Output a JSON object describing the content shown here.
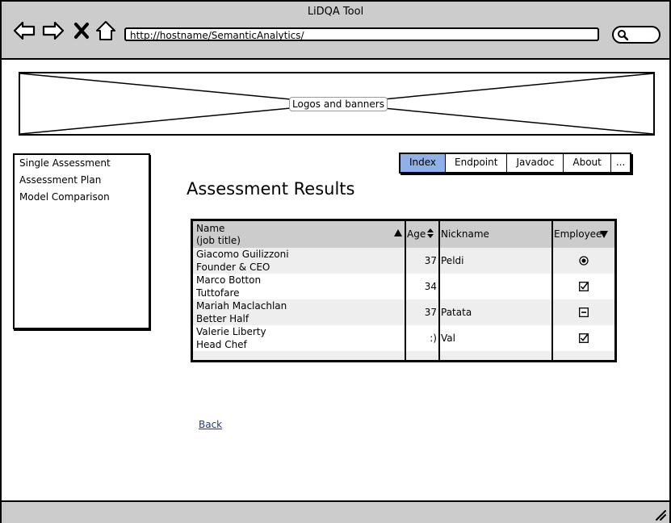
{
  "window": {
    "title": "LiDQA Tool"
  },
  "browser": {
    "url": "http://hostname/SemanticAnalytics/",
    "icons": [
      "back-arrow-icon",
      "forward-arrow-icon",
      "stop-icon",
      "home-icon",
      "search-icon"
    ]
  },
  "banner": {
    "label": "Logos and banners"
  },
  "sidebar": {
    "items": [
      {
        "label": "Single Assessment"
      },
      {
        "label": "Assessment Plan"
      },
      {
        "label": "Model Comparison"
      }
    ]
  },
  "tabs": [
    {
      "label": "Index",
      "selected": true
    },
    {
      "label": "Endpoint"
    },
    {
      "label": "Javadoc"
    },
    {
      "label": "About"
    },
    {
      "label": "..."
    }
  ],
  "page": {
    "title": "Assessment Results",
    "back_label": "Back"
  },
  "table": {
    "columns": {
      "name_line1": "Name",
      "name_line2": "(job title)",
      "age": "Age",
      "nickname": "Nickname",
      "employee": "Employee"
    },
    "rows": [
      {
        "name": "Giacomo Guilizzoni",
        "title": "Founder & CEO",
        "age": "37",
        "nickname": "Peldi",
        "employee": "radio-selected"
      },
      {
        "name": "Marco Botton",
        "title": "Tuttofare",
        "age": "34",
        "nickname": "",
        "employee": "checked"
      },
      {
        "name": "Mariah Maclachlan",
        "title": "Better Half",
        "age": "37",
        "nickname": "Patata",
        "employee": "indeterminate"
      },
      {
        "name": "Valerie Liberty",
        "title": "Head Chef",
        "age": ":)",
        "nickname": "Val",
        "employee": "checked"
      }
    ]
  },
  "colors": {
    "chrome": "#cccccc",
    "selected_tab": "#8fb0e8",
    "row_alt": "#eeeeee",
    "link": "#1a3e7e"
  }
}
